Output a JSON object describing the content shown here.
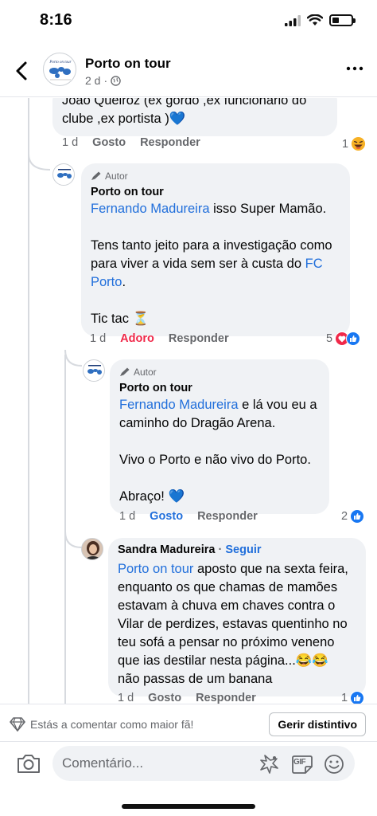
{
  "status_bar": {
    "time": "8:16",
    "battery_level": 0.35
  },
  "header": {
    "title": "Porto on tour",
    "meta_time": "2 d",
    "avatar_text": "Porto on tour",
    "privacy_icon": "globe-icon"
  },
  "comments": {
    "c1": {
      "text_line1": "Joao Queiroz (ex gordo ,ex funcionário do",
      "text_line2": "clube ,ex portista )",
      "text_emoji": "💙",
      "time": "1 d",
      "like": "Gosto",
      "reply": "Responder",
      "reaction_count": "1",
      "reaction_icon": "haha-icon"
    },
    "c2": {
      "badge": "Autor",
      "author": "Porto on tour",
      "mention": "Fernando Madureira",
      "line1_rest": " isso Super Mamão.",
      "line2": "Tens tanto jeito para a investigação como para viver a vida sem ser à custa do ",
      "line2_mention": "FC Porto",
      "line2_end": ".",
      "line3": "Tic tac",
      "line3_emoji": "⏳",
      "time": "1 d",
      "like": "Adoro",
      "reply": "Responder",
      "reaction_count": "5",
      "reaction_icons": [
        "love-icon",
        "like-icon"
      ],
      "like_color": "#f02849"
    },
    "c3": {
      "badge": "Autor",
      "author": "Porto on tour",
      "mention": "Fernando Madureira",
      "line1_rest": " e lá vou eu a caminho do Dragão Arena.",
      "line2": "Vivo o Porto e não vivo do Porto.",
      "line3": "Abraço!",
      "line3_emoji": "💙",
      "time": "1 d",
      "like": "Gosto",
      "reply": "Responder",
      "reaction_count": "2",
      "reaction_icon": "like-icon",
      "like_color": "#216fdb"
    },
    "c4": {
      "author": "Sandra Madureira",
      "separator": " · ",
      "follow": "Seguir",
      "mention": "Porto on tour",
      "text": " aposto que na sexta feira, enquanto os que chamas de mamões estavam à chuva em chaves contra o Vilar de perdizes, estavas quentinho no teu sofá a pensar no próximo veneno que ias destilar nesta página...",
      "emoji": "😂😂",
      "text_end": "não passas de um banana",
      "time": "1 d",
      "like": "Gosto",
      "reply": "Responder",
      "reaction_count": "1",
      "reaction_icon": "like-icon"
    }
  },
  "bottom": {
    "fan_text": "Estás a comentar como maior fã!",
    "fan_button": "Gerir distintivo",
    "comment_placeholder": "Comentário...",
    "gif_label": "GIF"
  },
  "colors": {
    "link": "#216fdb",
    "love": "#f02849",
    "like": "#1877f2",
    "muted": "#65676b"
  }
}
